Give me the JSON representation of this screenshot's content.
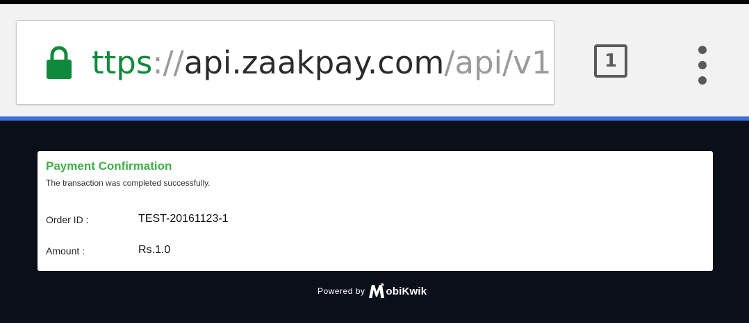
{
  "browser": {
    "url": {
      "scheme": "ttps",
      "separator": "://",
      "host": "api.zaakpay.com",
      "path": "/api/v1"
    },
    "tab_count": "1",
    "colors": {
      "secure_scheme": "#0f8a3c",
      "progress": "#3f6fd6"
    },
    "icons": {
      "lock": "lock-icon",
      "menu": "more-vert-icon"
    }
  },
  "confirmation": {
    "title": "Payment Confirmation",
    "subtitle": "The transaction was completed successfully.",
    "order_label": "Order ID :",
    "order_value": "TEST-20161123-1",
    "amount_label": "Amount :",
    "amount_value": "Rs.1.0"
  },
  "footer": {
    "powered_by": "Powered by",
    "brand": "obiKwik"
  }
}
